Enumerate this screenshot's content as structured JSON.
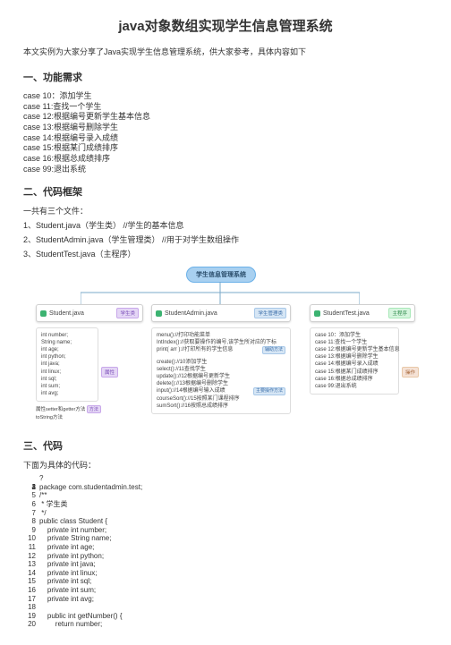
{
  "title": "java对象数组实现学生信息管理系统",
  "intro": "本文实例为大家分享了Java实现学生信息管理系统，供大家参考，具体内容如下",
  "sections": {
    "s1": "一、功能需求",
    "s2": "二、代码框架",
    "s3": "三、代码"
  },
  "cases": [
    "case 10：添加学生",
    "case 11:查找一个学生",
    "case 12:根据编号更新学生基本信息",
    "case 13:根据编号删除学生",
    "case 14:根据编号录入成绩",
    "case 15:根据某门成绩排序",
    "case 16:根据总成绩排序",
    "case 99:退出系统"
  ],
  "frame_intro": "一共有三个文件：",
  "files": [
    "1、Student.java（学生类） //学生的基本信息",
    "2、StudentAdmin.java（学生管理类） //用于对学生数组操作",
    "3、StudentTest.java（主程序）"
  ],
  "diagram": {
    "top": "学生信息管理系统",
    "mod1": {
      "name": "Student.java",
      "tag": "学生类",
      "body": [
        "int number;",
        "String name;",
        "int age;",
        "int python;",
        "int java;",
        "int linux;",
        "int sql;",
        "int sum;",
        "int avg;"
      ],
      "footer": "属性setter和getter方法",
      "footer2": "toString方法",
      "sideTag": "方法"
    },
    "mod2": {
      "name": "StudentAdmin.java",
      "tag": "学生管理类",
      "body1": [
        "menu()://打印功能菜单",
        "IntIndex()://获取要操作的编号,该学生所对应的下标",
        "print( arr )://打印所有的学生信息"
      ],
      "body1Tag": "辅助方法",
      "body2": [
        "create()://10添加学生",
        "select()://11查找学生",
        "update()://12根据编号更新学生",
        "delete()://13根据编号删除学生",
        "input()://14根据编号输入成绩",
        "courseSort()://15按照某门课程排序",
        "sumSort()://16按照总成绩排序"
      ],
      "body2Tag": "主要操作方法"
    },
    "mod3": {
      "name": "StudentTest.java",
      "tag": "主程序",
      "body": [
        "case 10：添加学生",
        "case 11:查找一个学生",
        "case 12:根据编号更新学生基本信息",
        "case 13:根据编号删除学生",
        "case 14:根据编号录入成绩",
        "case 15:根据某门成绩排序",
        "case 16:根据总成绩排序",
        "case 99:退出系统"
      ],
      "sideTag": "操作"
    }
  },
  "code_label": "下面为具体的代码：",
  "code": {
    "prefix": "?",
    "lines": [
      "",
      "",
      "",
      "package com.studentadmin.test;",
      "/**",
      " * 学生类",
      " */",
      "public class Student {",
      "    private int number;",
      "    private String name;",
      "    private int age;",
      "    private int python;",
      "    private int java;",
      "    private int linux;",
      "    private int sql;",
      "    private int sum;",
      "    private int avg;",
      "    ",
      "    public int getNumber() {",
      "        return number;"
    ]
  }
}
